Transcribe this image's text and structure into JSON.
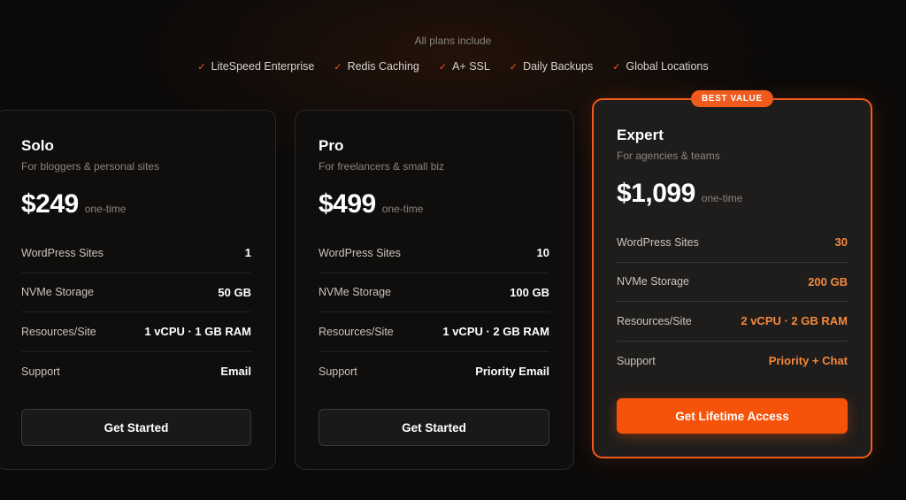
{
  "includes": {
    "title": "All plans include",
    "items": [
      "LiteSpeed Enterprise",
      "Redis Caching",
      "A+ SSL",
      "Daily Backups",
      "Global Locations"
    ]
  },
  "plans": [
    {
      "name": "Solo",
      "description": "For bloggers & personal sites",
      "price": "$249",
      "price_note": "one-time",
      "features": [
        {
          "label": "WordPress Sites",
          "value": "1"
        },
        {
          "label": "NVMe Storage",
          "value": "50 GB"
        },
        {
          "label": "Resources/Site",
          "value": "1 vCPU · 1 GB RAM"
        },
        {
          "label": "Support",
          "value": "Email"
        }
      ],
      "cta": "Get Started"
    },
    {
      "name": "Pro",
      "description": "For freelancers & small biz",
      "price": "$499",
      "price_note": "one-time",
      "features": [
        {
          "label": "WordPress Sites",
          "value": "10"
        },
        {
          "label": "NVMe Storage",
          "value": "100 GB"
        },
        {
          "label": "Resources/Site",
          "value": "1 vCPU · 2 GB RAM"
        },
        {
          "label": "Support",
          "value": "Priority Email"
        }
      ],
      "cta": "Get Started"
    },
    {
      "name": "Expert",
      "badge": "BEST VALUE",
      "description": "For agencies & teams",
      "price": "$1,099",
      "price_note": "one-time",
      "features": [
        {
          "label": "WordPress Sites",
          "value": "30"
        },
        {
          "label": "NVMe Storage",
          "value": "200 GB"
        },
        {
          "label": "Resources/Site",
          "value": "2 vCPU · 2 GB RAM"
        },
        {
          "label": "Support",
          "value": "Priority + Chat"
        }
      ],
      "cta": "Get Lifetime Access"
    }
  ],
  "colors": {
    "accent": "#f05a1a",
    "accent_text": "#f5883c",
    "background": "#0b0a09"
  },
  "icons": {
    "include_item": "check-icon"
  }
}
